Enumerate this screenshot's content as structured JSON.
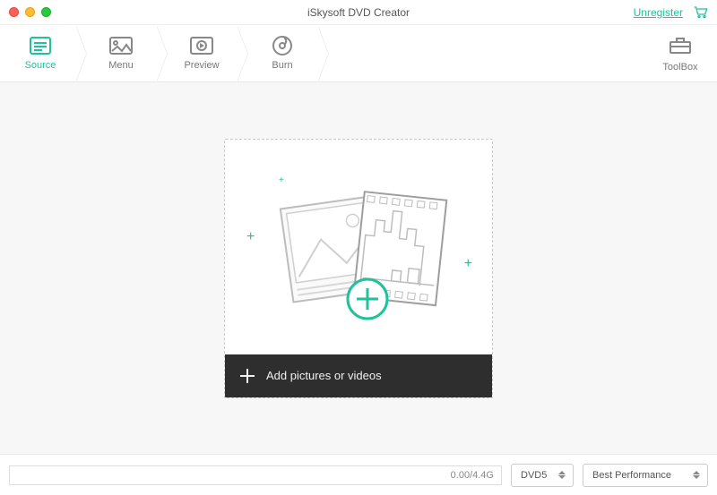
{
  "titlebar": {
    "app_title": "iSkysoft DVD Creator",
    "unregister_label": "Unregister"
  },
  "steps": {
    "items": [
      {
        "label": "Source"
      },
      {
        "label": "Menu"
      },
      {
        "label": "Preview"
      },
      {
        "label": "Burn"
      }
    ],
    "toolbox_label": "ToolBox",
    "active_index": 0
  },
  "dropzone": {
    "footer_label": "Add pictures or videos"
  },
  "bottom": {
    "capacity_text": "0.00/4.4G",
    "disc_type": "DVD5",
    "quality": "Best Performance"
  },
  "colors": {
    "accent": "#1fc29b"
  }
}
